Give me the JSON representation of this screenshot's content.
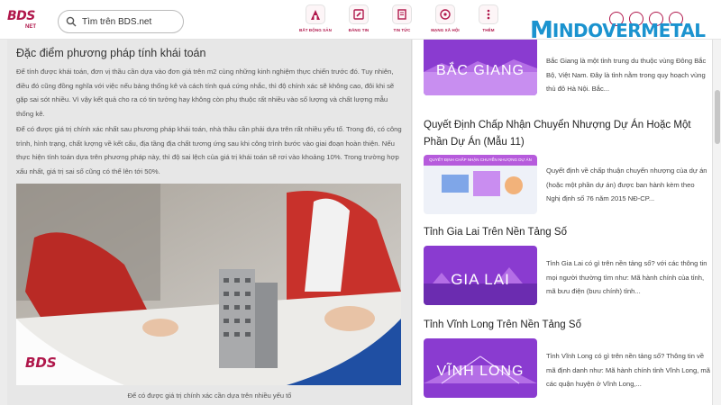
{
  "header": {
    "logo_text": "BDS",
    "logo_sub": "NET",
    "search_placeholder": "Tìm trên BDS.net",
    "nav": [
      {
        "label": "BẤT ĐỘNG SẢN",
        "icon": "building-icon"
      },
      {
        "label": "ĐĂNG TIN",
        "icon": "post-icon"
      },
      {
        "label": "TIN TỨC",
        "icon": "news-icon"
      },
      {
        "label": "MẠNG XÃ HỘI",
        "icon": "network-icon"
      },
      {
        "label": "THÊM",
        "icon": "more-icon"
      }
    ]
  },
  "watermark": {
    "m": "M",
    "rest": "INDOVERMETAL"
  },
  "article": {
    "title": "Đặc điểm phương pháp tính khái toán",
    "paragraph1": "Để tính được khái toán, đơn vị thầu cần dựa vào đơn giá trên m2 cùng những kinh nghiệm thực chiến trước đó. Tuy nhiên, điều đó cũng đồng nghĩa với việc nếu bảng thống kê và cách tính quá cứng nhắc, thì độ chính xác sẽ không cao, đôi khi sẽ gặp sai sót nhiều. Vì vậy kết quả cho ra có tin tưởng hay không còn phụ thuộc rất nhiều vào số lượng và chất lượng mẫu thống kê.",
    "paragraph2": "Để có được giá trị chính xác nhất sau phương pháp khái toán, nhà thầu cần phải dựa trên rất nhiều yếu tố. Trong đó, có công trình, hình trạng, chất lượng về kết cấu, địa tầng địa chất tương ứng sau khi công trình bước vào giai đoạn hoàn thiện. Nếu thực hiện tính toán dựa trên phương pháp này, thì độ sai lệch của giá trị khái toán sẽ rơi vào khoảng 10%. Trong trường hợp xấu nhất, giá trị sai số cũng có thể lên tới 50%.",
    "image_logo": "BDS",
    "caption": "Để có được giá trị chính xác cần dựa trên nhiều yếu tố"
  },
  "sidebar": {
    "cards": [
      {
        "title": "",
        "thumb_text": "BẮC GIANG",
        "desc": "Bắc Giang là một tỉnh trung du thuộc vùng Đông Bắc Bộ, Việt Nam. Đây là tỉnh nằm trong quy hoạch vùng thủ đô Hà Nội. Bắc..."
      },
      {
        "title": "Quyết Định Chấp Nhận Chuyển Nhượng Dự Án Hoặc Một Phần Dự Án (Mẫu 11)",
        "thumb_text": "QUYẾT ĐỊNH CHẤP NHẬN CHUYỂN NHƯỢNG DỰ ÁN",
        "desc": "Quyết định về chấp thuận chuyển nhượng của dự án (hoặc một phần dự án) được ban hành kèm theo Nghị định số 76 năm 2015 NĐ-CP..."
      },
      {
        "title": "Tỉnh Gia Lai Trên Nền Tảng Số",
        "thumb_text": "GIA LAI",
        "desc": "Tỉnh Gia Lai có gì trên nền tảng số? với các thông tin mọi người thường tìm như: Mã hành chính của tỉnh, mã bưu điện (bưu chính) tỉnh..."
      },
      {
        "title": "Tỉnh Vĩnh Long Trên Nền Tảng Số",
        "thumb_text": "VĨNH LONG",
        "desc": "Tỉnh Vĩnh Long có gì trên nền tảng số? Thông tin về mã định danh như: Mã hành chính tỉnh Vĩnh Long, mã các quận huyện ở Vĩnh Long,..."
      }
    ]
  },
  "colors": {
    "brand": "#b0174b",
    "watermark": "#1b93cf",
    "thumb_purple": "#8a3bd0"
  }
}
